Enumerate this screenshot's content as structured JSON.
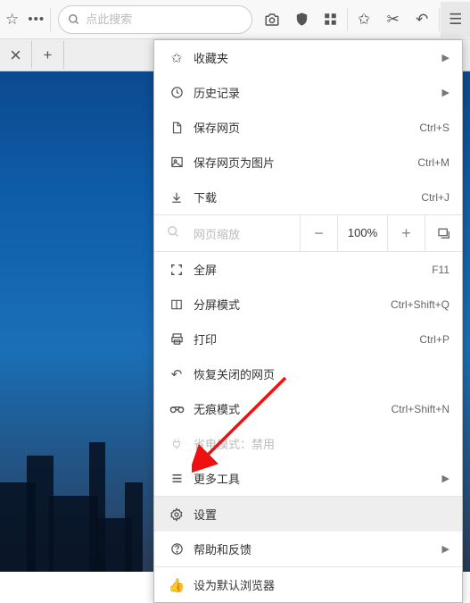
{
  "search": {
    "placeholder": "点此搜索"
  },
  "zoom": {
    "label": "网页缩放",
    "value": "100%"
  },
  "menu": {
    "favorites": "收藏夹",
    "history": "历史记录",
    "savePage": "保存网页",
    "saveImage": "保存网页为图片",
    "download": "下载",
    "fullscreen": "全屏",
    "splitScreen": "分屏模式",
    "print": "打印",
    "reopenClosed": "恢复关闭的网页",
    "incognito": "无痕模式",
    "powerSave": "省电模式：禁用",
    "moreTools": "更多工具",
    "settings": "设置",
    "help": "帮助和反馈",
    "setDefault": "设为默认浏览器"
  },
  "shortcuts": {
    "savePage": "Ctrl+S",
    "saveImage": "Ctrl+M",
    "download": "Ctrl+J",
    "fullscreen": "F11",
    "splitScreen": "Ctrl+Shift+Q",
    "print": "Ctrl+P",
    "incognito": "Ctrl+Shift+N"
  }
}
